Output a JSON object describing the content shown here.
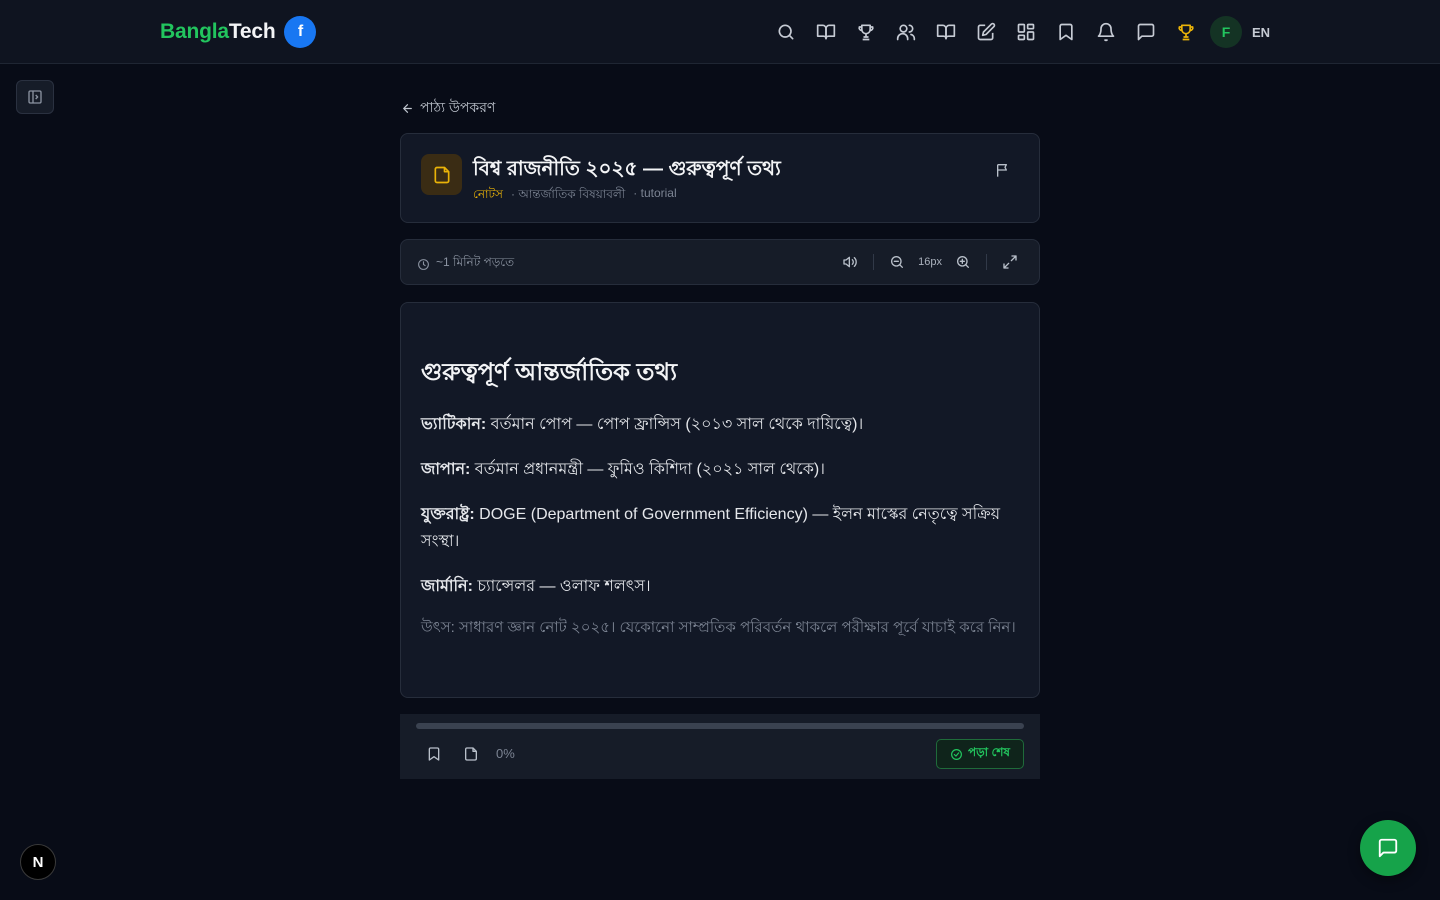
{
  "brand": {
    "part1": "Bangla",
    "part2": "Tech",
    "facebook_glyph": "f"
  },
  "nav": {
    "icons": [
      "search-icon",
      "book-open-icon",
      "trophy-icon",
      "users-icon",
      "book-icon",
      "edit-icon",
      "grid-icon",
      "bookmark-icon",
      "bell-icon",
      "message-icon",
      "trophy-gold-icon"
    ],
    "avatar_letter": "F",
    "lang": "EN"
  },
  "back_link": {
    "label": "পাঠ্য উপকরণ"
  },
  "document": {
    "title": "বিশ্ব রাজনীতি ২০২৫ — গুরুত্বপূর্ণ তথ্য",
    "category": "নোটস",
    "subcategory": "· আন্তর্জাতিক বিষয়াবলী",
    "type": "· tutorial"
  },
  "toolbar": {
    "read_time": "~1 মিনিট পড়তে",
    "font_size": "16px"
  },
  "content": {
    "heading": "গুরুত্বপূর্ণ আন্তর্জাতিক তথ্য",
    "items": [
      {
        "label": "ভ্যাটিকান:",
        "text": " বর্তমান পোপ — পোপ ফ্রান্সিস (২০১৩ সাল থেকে দায়িত্বে)।"
      },
      {
        "label": "জাপান:",
        "text": " বর্তমান প্রধানমন্ত্রী — ফুমিও কিশিদা (২০২১ সাল থেকে)।"
      },
      {
        "label": "যুক্তরাষ্ট্র:",
        "text": " DOGE (Department of Government Efficiency) — ইলন মাস্কের নেতৃত্বে সক্রিয় সংস্থা।"
      },
      {
        "label": "জার্মানি:",
        "text": " চ্যান্সেলর — ওলাফ শলৎস।"
      }
    ],
    "source": "উৎস: সাধারণ জ্ঞান নোট ২০২৫। যেকোনো সাম্প্রতিক পরিবর্তন থাকলে পরীক্ষার পূর্বে যাচাই করে নিন।"
  },
  "footer": {
    "progress": 0,
    "percent_label": "0%",
    "done_label": "পড়া শেষ"
  },
  "colors": {
    "accent": "#22c55e",
    "gold": "#eab308",
    "facebook": "#1877f2"
  },
  "next_badge": "N"
}
